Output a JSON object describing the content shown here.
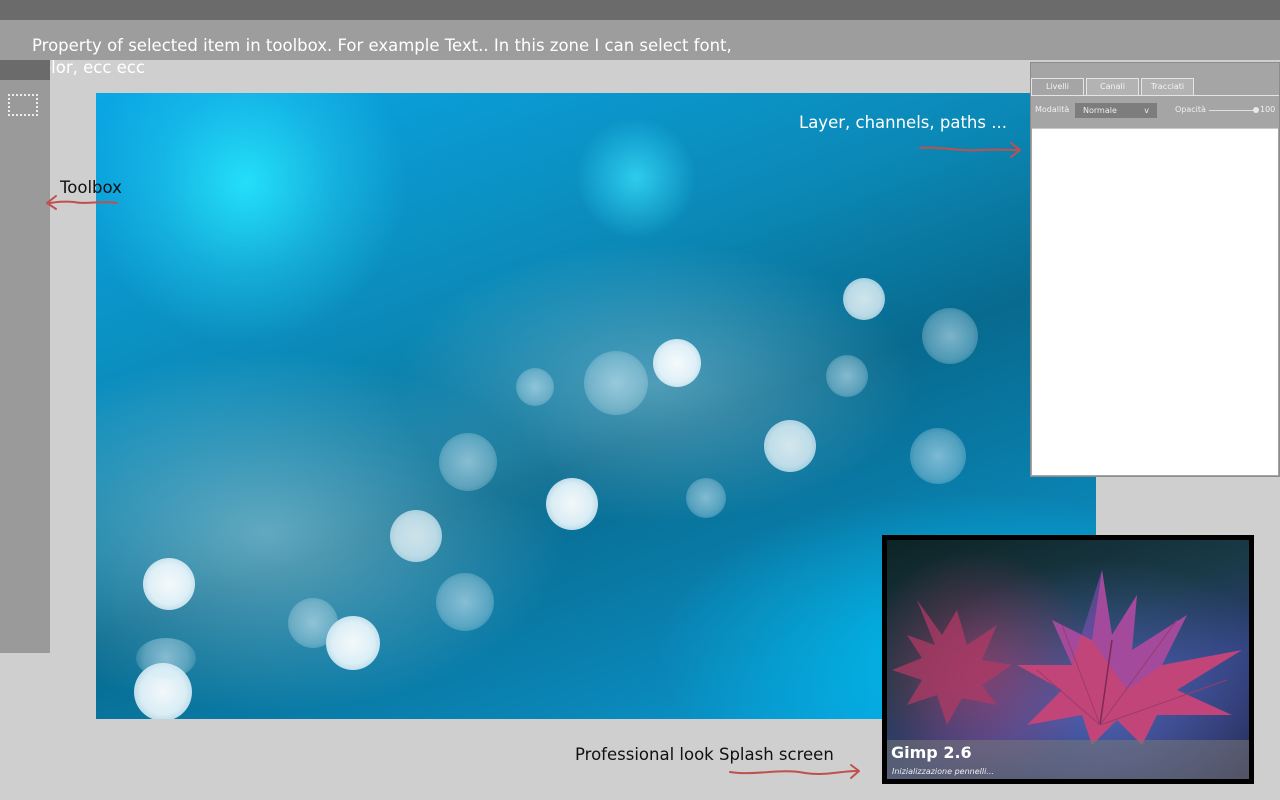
{
  "annotations": {
    "properties_zone": "Property of selected item in toolbox. For example Text.. In this zone I can select font, color, ecc ecc",
    "toolbox": "Toolbox",
    "layers_panel": "Layer, channels, paths ...",
    "splash": "Professional look Splash screen"
  },
  "toolbox": {
    "tools": [
      {
        "icon": "rect-select-icon"
      }
    ]
  },
  "layers_panel": {
    "tabs": [
      "Livelli",
      "Canali",
      "Tracciati"
    ],
    "mode_label": "Modalità",
    "mode_value": "Normale",
    "mode_chevron": "v",
    "opacity_label": "Opacità",
    "opacity_value": "100"
  },
  "splash": {
    "title": "Gimp 2.6",
    "status": "Inizializzazione pennelli..."
  },
  "colors": {
    "arrow": "#c0504d",
    "topbar": "#6b6b6b",
    "props_zone": "#9d9d9d",
    "toolbox": "#9a9a9a",
    "background": "#cfcfcf"
  }
}
